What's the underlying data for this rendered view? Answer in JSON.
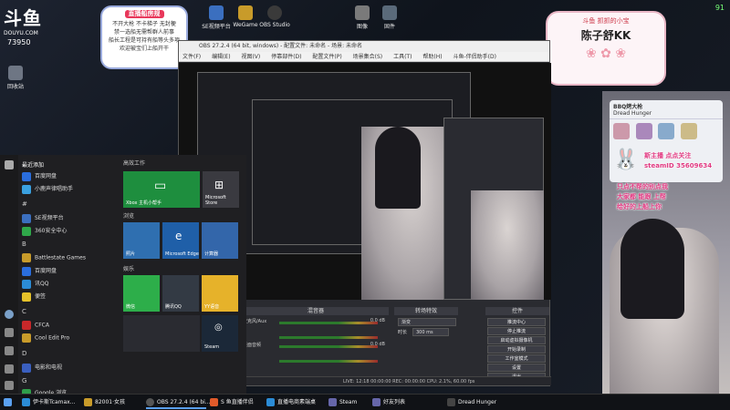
{
  "stream": {
    "logo": "斗鱼",
    "logo_url": "DOUYU.COM",
    "room_no": "73950",
    "fps": "91",
    "sign_title": "直播船房规",
    "sign_lines": [
      "不开大枪 不卡梯子 无封梗",
      "禁一选船无需帮群人前事",
      "船长工程是可持有船等头多项",
      "欢迎被宝们上船开干"
    ],
    "name_banner_sub": "斗鱼 抓抓的小宝",
    "name": "陈子舒KK"
  },
  "desktop_icons": [
    {
      "label": "回收站",
      "color": "#6e7684"
    },
    {
      "label": "SE视频平台",
      "color": "#3b6fbf"
    },
    {
      "label": "WeGame",
      "color": "#c89b2a"
    },
    {
      "label": "OBS Studio",
      "color": "#3a3a3a"
    },
    {
      "label": "图像",
      "color": "#7a7a7a"
    },
    {
      "label": "固件",
      "color": "#5a6a7a"
    }
  ],
  "start_menu": {
    "recent_header": "最近添加",
    "apps": [
      {
        "label": "百度网盘",
        "color": "#2a6ede"
      },
      {
        "label": "小鹿声律唱助手",
        "color": "#3aa0e0"
      },
      {
        "label": "SE视频平台",
        "color": "#3b6fbf"
      },
      {
        "label": "360安全中心",
        "color": "#2fa84a"
      },
      {
        "label": "Battlestate Games",
        "color": "#c89b2a"
      },
      {
        "label": "百度网盘",
        "color": "#2a6ede"
      },
      {
        "label": "讯QQ",
        "color": "#2b8cd6"
      },
      {
        "label": "便签",
        "color": "#e6c22a"
      },
      {
        "label": "CFCA",
        "color": "#c8282a"
      },
      {
        "label": "Cool Edit Pro",
        "color": "#c89b2a"
      },
      {
        "label": "电影和电视",
        "color": "#3a5fbf"
      },
      {
        "label": "Google 浏览",
        "color": "#2f9e4a"
      }
    ],
    "letters": [
      "#",
      "B",
      "C",
      "D",
      "G"
    ],
    "sections": [
      "高效工作",
      "浏览",
      "娱乐"
    ],
    "tiles": [
      {
        "label": "Xbox 主机小帮手",
        "color": "#1e8e3e"
      },
      {
        "label": "Microsoft Store",
        "color": "#3a3a40"
      },
      {
        "label": "照片",
        "color": "#2f6fb0"
      },
      {
        "label": "Microsoft Edge",
        "color": "#1f5fa8"
      },
      {
        "label": "计算器",
        "color": "#3366aa"
      },
      {
        "label": "微信",
        "color": "#2dae4a"
      },
      {
        "label": "腾讯QQ",
        "color": "#333a44"
      },
      {
        "label": "YY语音",
        "color": "#e6b22a"
      },
      {
        "label": "Steam",
        "color": "#1b2838"
      }
    ]
  },
  "obs": {
    "title": "OBS 27.2.4 (64 bit, windows) - 配置文件: 未命名 - 场景: 未命名",
    "menu": [
      "文件(F)",
      "编辑(E)",
      "视图(V)",
      "停靠部件(D)",
      "配置文件(P)",
      "场景集合(S)",
      "工具(T)",
      "帮助(H)",
      "斗鱼-伴侣助手(D)"
    ],
    "mixer_title": "混音器",
    "transition_title": "转场特效",
    "controls_title": "控件",
    "mixer": [
      {
        "name": "麦克风/Aux",
        "db": "0.0 dB"
      },
      {
        "name": "桌面音频",
        "db": "0.0 dB"
      }
    ],
    "transition": {
      "type": "渐变",
      "duration_label": "时长",
      "duration": "300 ms"
    },
    "controls": [
      "推流中心",
      "停止推流",
      "启动虚拟摄像机",
      "开始录制",
      "工作室模式",
      "设置",
      "退出"
    ],
    "status": "LIVE: 12:18  00:00:00  REC: 00:00:00  CPU: 2.1%, 60.00 fps"
  },
  "chat": {
    "header": "BBQ烤大枪",
    "sub": "Dread Hunger",
    "lines": [
      "斯主播 点点关注",
      "steamID 35609634",
      "只点不帮的别点我",
      "大家都 能跟 上帮",
      "给好的上船上你"
    ]
  },
  "taskbar": [
    {
      "label": "伊卡斯Tcamax...",
      "color": "#2b8cd6"
    },
    {
      "label": "82001·女孩",
      "color": "#c89b2a"
    },
    {
      "label": "OBS 27.2.4 (64 bi...",
      "color": "#3a3a3a"
    },
    {
      "label": "S 鱼直播伴侣",
      "color": "#e05a2a"
    },
    {
      "label": "直播电商素端桌",
      "color": "#2b8cd6"
    },
    {
      "label": "Steam",
      "color": "#1b2838"
    },
    {
      "label": "好友列表",
      "color": "#1b2838"
    },
    {
      "label": "Dread Hunger",
      "color": "#333"
    }
  ]
}
